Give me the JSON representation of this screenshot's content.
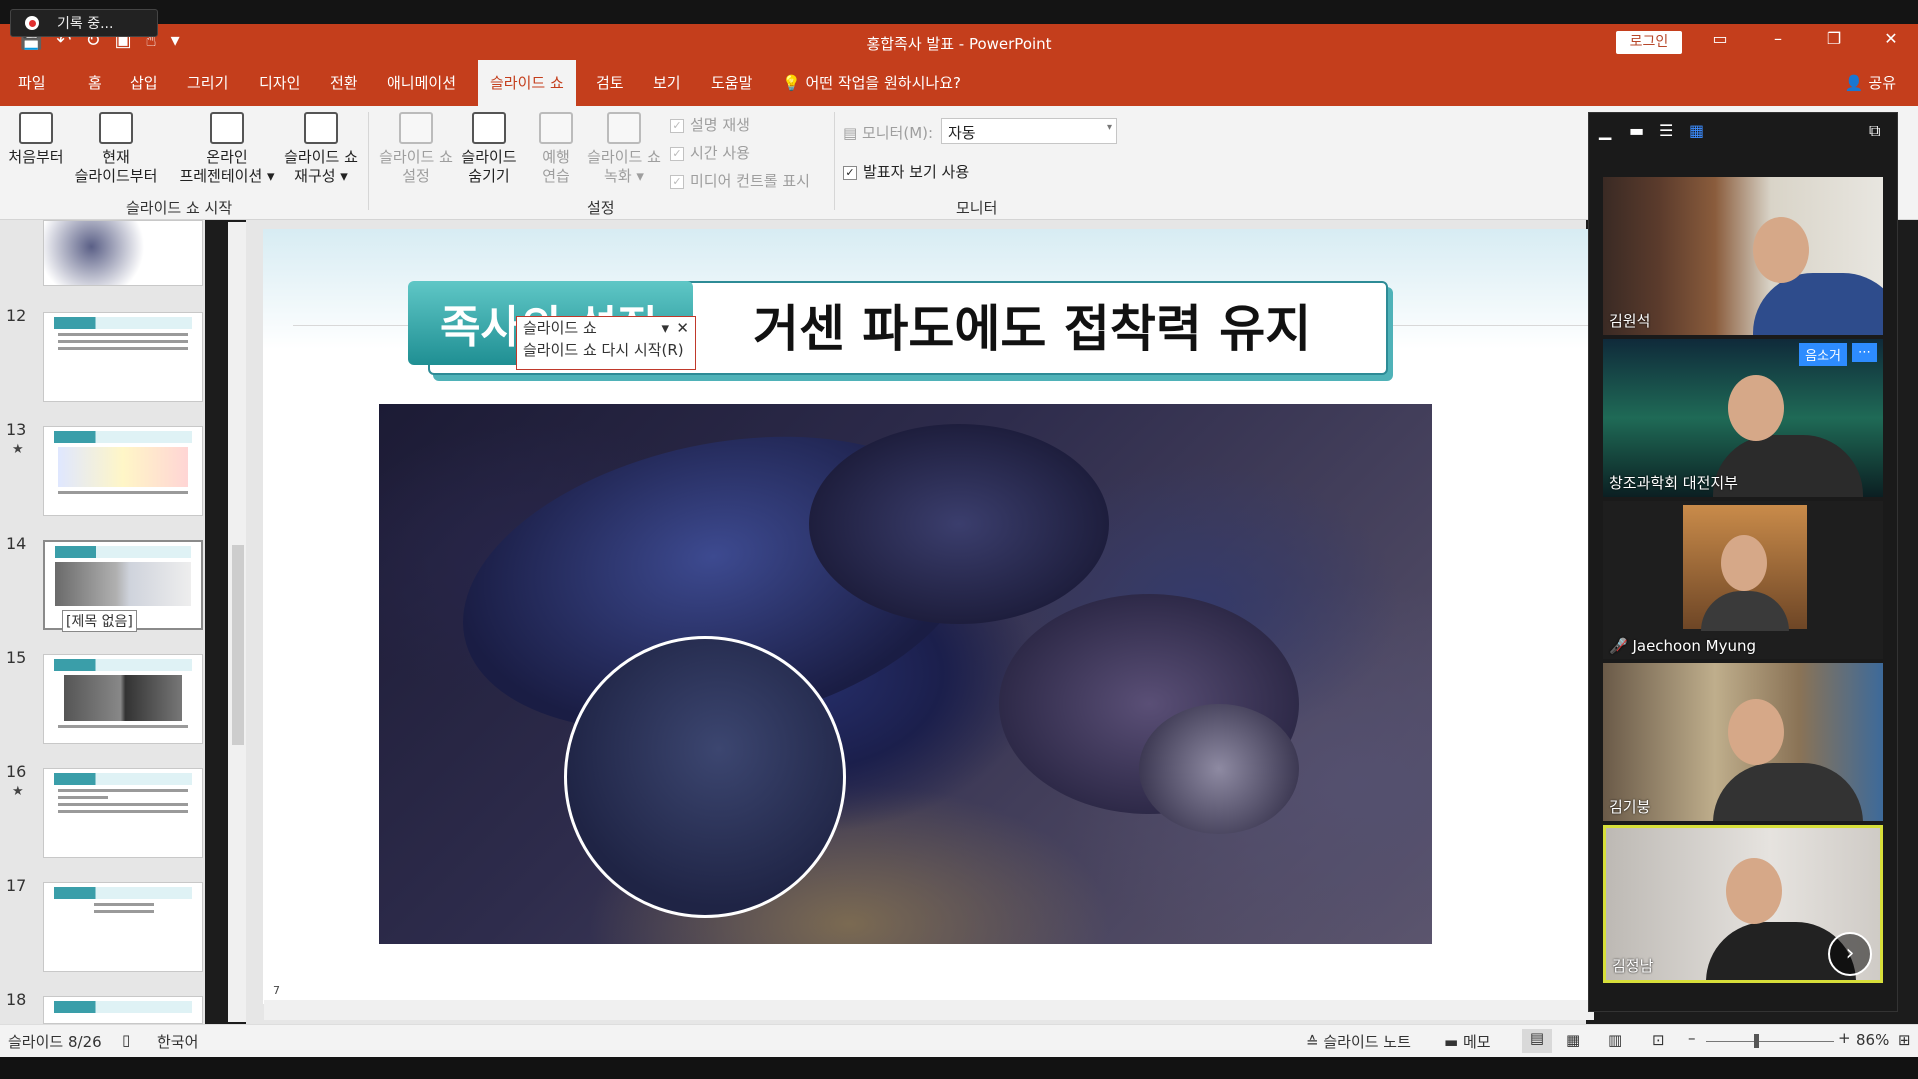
{
  "recording": "기록 중...",
  "app": {
    "title": "홍합족사 발표  -  PowerPoint",
    "login": "로그인",
    "share": "공유"
  },
  "tabs": [
    "파일",
    "홈",
    "삽입",
    "그리기",
    "디자인",
    "전환",
    "애니메이션",
    "슬라이드 쇼",
    "검토",
    "보기",
    "도움말",
    "어떤 작업을 원하시나요?"
  ],
  "ribbon": {
    "start": [
      "처음부터",
      "현재\n슬라이드부터",
      "온라인\n프레젠테이션 ▾",
      "슬라이드 쇼\n재구성 ▾"
    ],
    "group1": "슬라이드 쇼 시작",
    "setup": [
      "슬라이드 쇼\n설정",
      "슬라이드\n숨기기",
      "예행\n연습",
      "슬라이드 쇼\n녹화 ▾"
    ],
    "checks": [
      "설명 재생",
      "시간 사용",
      "미디어 컨트롤 표시"
    ],
    "group2": "설정",
    "monitor_label": "모니터(M):",
    "monitor_value": "자동",
    "presenter": "발표자 보기 사용",
    "group3": "모니터"
  },
  "thumbs": [
    {
      "num": "12",
      "star": ""
    },
    {
      "num": "13",
      "star": "★"
    },
    {
      "num": "14",
      "star": "",
      "label": "[제목 없음]"
    },
    {
      "num": "15",
      "star": ""
    },
    {
      "num": "16",
      "star": "★"
    },
    {
      "num": "17",
      "star": ""
    },
    {
      "num": "18",
      "star": ""
    }
  ],
  "slide": {
    "badge": "족사의 설질",
    "title": "거센 파도에도 접착력 유지",
    "page": "7"
  },
  "popup": {
    "title": "슬라이드 쇼",
    "item": "슬라이드 쇼 다시 시작(R)"
  },
  "status": {
    "slide": "슬라이드 8/26",
    "lang": "한국어",
    "notes": "슬라이드 노트",
    "comments": "메모",
    "zoom": "86%"
  },
  "participants": [
    {
      "name": "김원석"
    },
    {
      "name": "창조과학회 대전지부",
      "badge": "음소거"
    },
    {
      "name": "Jaechoon Myung"
    },
    {
      "name": "김기붕"
    },
    {
      "name": "김정남"
    }
  ]
}
